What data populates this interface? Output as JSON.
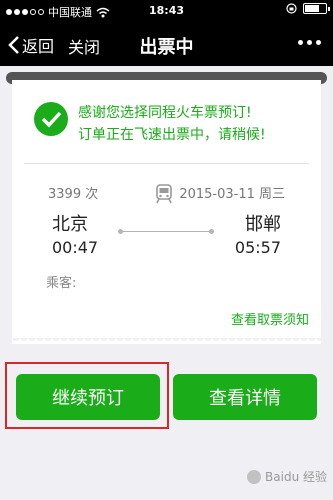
{
  "status_bar": {
    "carrier": "中国联通",
    "time": "18:43"
  },
  "nav": {
    "back_label": "返回",
    "close_label": "关闭",
    "title": "出票中"
  },
  "ticket": {
    "message_line1": "感谢您选择同程火车票预订!",
    "message_line2": "订单正在飞速出票中，请稍候!",
    "train_number": "3399 次",
    "date": "2015-03-11 周三",
    "from_city": "北京",
    "from_time": "00:47",
    "to_city": "邯郸",
    "to_time": "05:57",
    "passenger_label": "乘客:",
    "notice_link": "查看取票须知"
  },
  "buttons": {
    "continue": "继续预订",
    "details": "查看详情"
  },
  "watermark": "Baidu 经验",
  "colors": {
    "accent": "#1aad19",
    "highlight": "#d8282a",
    "bar": "#000000"
  }
}
